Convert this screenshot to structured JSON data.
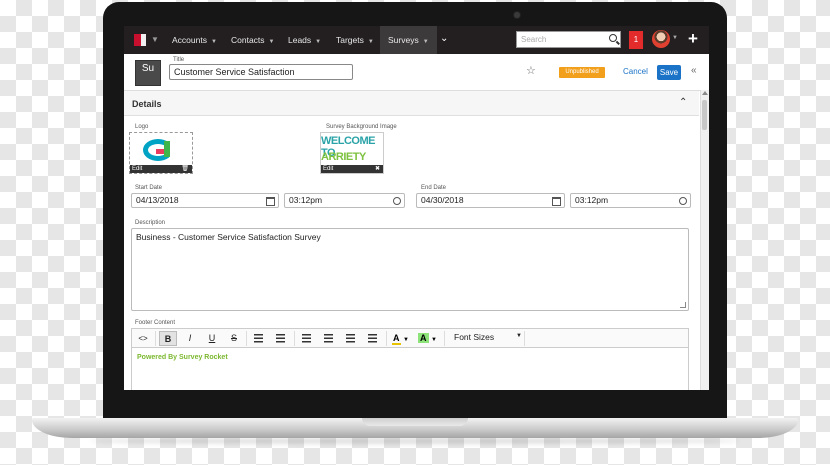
{
  "nav": {
    "items": [
      {
        "label": "Accounts"
      },
      {
        "label": "Contacts"
      },
      {
        "label": "Leads"
      },
      {
        "label": "Targets"
      },
      {
        "label": "Surveys"
      }
    ],
    "search_placeholder": "Search",
    "notification_count": "1"
  },
  "header": {
    "record_badge": "Su",
    "title_label": "Title",
    "title_value": "Customer Service Satisfaction",
    "status": "Unpublished",
    "cancel_label": "Cancel",
    "save_label": "Save"
  },
  "details": {
    "section_title": "Details",
    "logo_label": "Logo",
    "logo_edit": "Edit",
    "bg_image_label": "Survey Background Image",
    "bg_image_edit": "Edit",
    "bg_image_text_line1": "WELCOME TO",
    "bg_image_text_line2": "ARRIETY",
    "start_date_label": "Start Date",
    "start_date": "04/13/2018",
    "start_time": "03:12pm",
    "end_date_label": "End Date",
    "end_date": "04/30/2018",
    "end_time": "03:12pm",
    "description_label": "Description",
    "description": "Business - Customer Service Satisfaction Survey",
    "footer_label": "Footer Content",
    "font_sizes_label": "Font Sizes",
    "footer_text": "Powered By Survey Rocket"
  },
  "toolbar": {
    "code": "<>",
    "bold": "B",
    "italic": "I",
    "underline": "U",
    "strike": "S",
    "text_color": "A",
    "bg_color": "A"
  },
  "colors": {
    "nav_bg": "#231f20",
    "accent": "#1b73c7",
    "badge": "#f29f1c",
    "notification": "#e32b2b",
    "footer_text": "#7cb82f"
  }
}
